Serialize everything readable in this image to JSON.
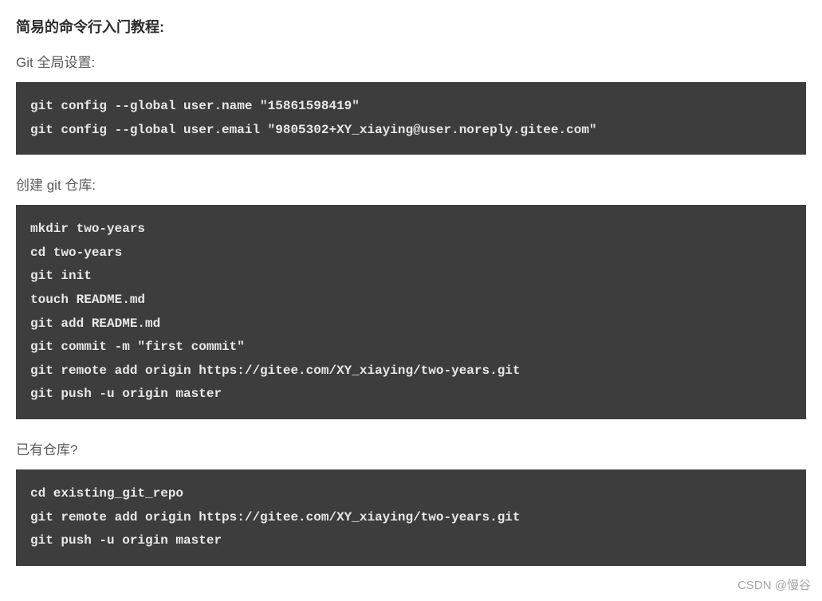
{
  "title": "简易的命令行入门教程:",
  "section1": {
    "subtitle": "Git 全局设置:",
    "code": "git config --global user.name \"15861598419\"\ngit config --global user.email \"9805302+XY_xiaying@user.noreply.gitee.com\""
  },
  "section2": {
    "subtitle": "创建 git 仓库:",
    "code": "mkdir two-years\ncd two-years\ngit init\ntouch README.md\ngit add README.md\ngit commit -m \"first commit\"\ngit remote add origin https://gitee.com/XY_xiaying/two-years.git\ngit push -u origin master"
  },
  "section3": {
    "subtitle": "已有仓库?",
    "code": "cd existing_git_repo\ngit remote add origin https://gitee.com/XY_xiaying/two-years.git\ngit push -u origin master"
  },
  "watermark": "CSDN @慢谷"
}
